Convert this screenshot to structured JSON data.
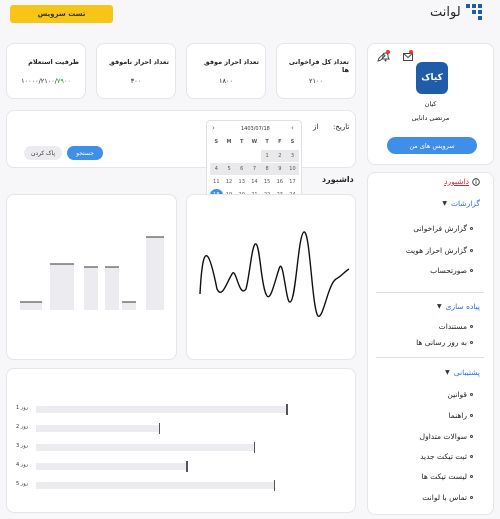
{
  "header": {
    "service_btn": "تست سرویس",
    "logo": "لوانت"
  },
  "stats": [
    {
      "title": "تعداد کل فراخوانی ها",
      "value": "۲۱۰۰"
    },
    {
      "title": "تعداد احراز موفق",
      "value": "۱۸۰۰"
    },
    {
      "title": "تعداد احراز ناموفق",
      "value": "۳۰۰"
    },
    {
      "title": "ظرفیت استعلام",
      "value_main": "۱۰۰۰۰/۲۱۰۰/",
      "value_green": "۷۹۰۰"
    }
  ],
  "profile": {
    "avatar_text": "کیاک",
    "name": "کیان",
    "role": "مرتضی دانایی",
    "button": "سرویس های من"
  },
  "filter": {
    "date_label": "تاریخ:",
    "from_label": "از",
    "date_value": "1403/07/18",
    "search_btn": "جستجو",
    "clear_btn": "پاک کردن"
  },
  "calendar": {
    "weekdays": [
      "S",
      "M",
      "T",
      "W",
      "T",
      "F",
      "S"
    ],
    "weeks": [
      [
        "",
        "",
        "",
        "",
        "1",
        "2",
        "3"
      ],
      [
        "4",
        "5",
        "6",
        "7",
        "8",
        "9",
        "10"
      ],
      [
        "11",
        "12",
        "13",
        "14",
        "15",
        "16",
        "17"
      ],
      [
        "18",
        "19",
        "20",
        "21",
        "22",
        "23",
        "24"
      ],
      [
        "25",
        "26",
        "27",
        "28",
        "29",
        "30",
        ""
      ]
    ],
    "selected": "18"
  },
  "dashboard_title": "داشبورد",
  "sidebar": {
    "dashboard": "داشبورد",
    "reports": "گزارشات",
    "report_items": [
      "گزارش فراخوانی",
      "گزارش احراز هویت",
      "صورتحساب"
    ],
    "implementation": "پیاده سازی",
    "impl_items": [
      "مستندات",
      "به روز رسانی ها"
    ],
    "support": "پشتیبانی",
    "support_items": [
      "قوانین",
      "راهنما",
      "سوالات متداول",
      "ثبت تیکت جدید",
      "لیست تیکت ها",
      "تماس با لوانت"
    ]
  },
  "chart_data": [
    {
      "type": "bar",
      "categories": [
        "1",
        "2",
        "3",
        "4",
        "5",
        "6"
      ],
      "values": [
        8,
        46,
        43,
        43,
        8,
        73
      ]
    },
    {
      "type": "line"
    },
    {
      "type": "bar",
      "orientation": "horizontal",
      "categories": [
        "روز 1",
        "روز 2",
        "روز 3",
        "روز 4",
        "روز 5"
      ],
      "values": [
        100,
        49,
        87,
        60,
        95
      ]
    }
  ],
  "colors": {
    "accent": "#3e8eea",
    "brand": "#1f5da8",
    "yellow": "#f7c518",
    "red": "#d9262c"
  }
}
